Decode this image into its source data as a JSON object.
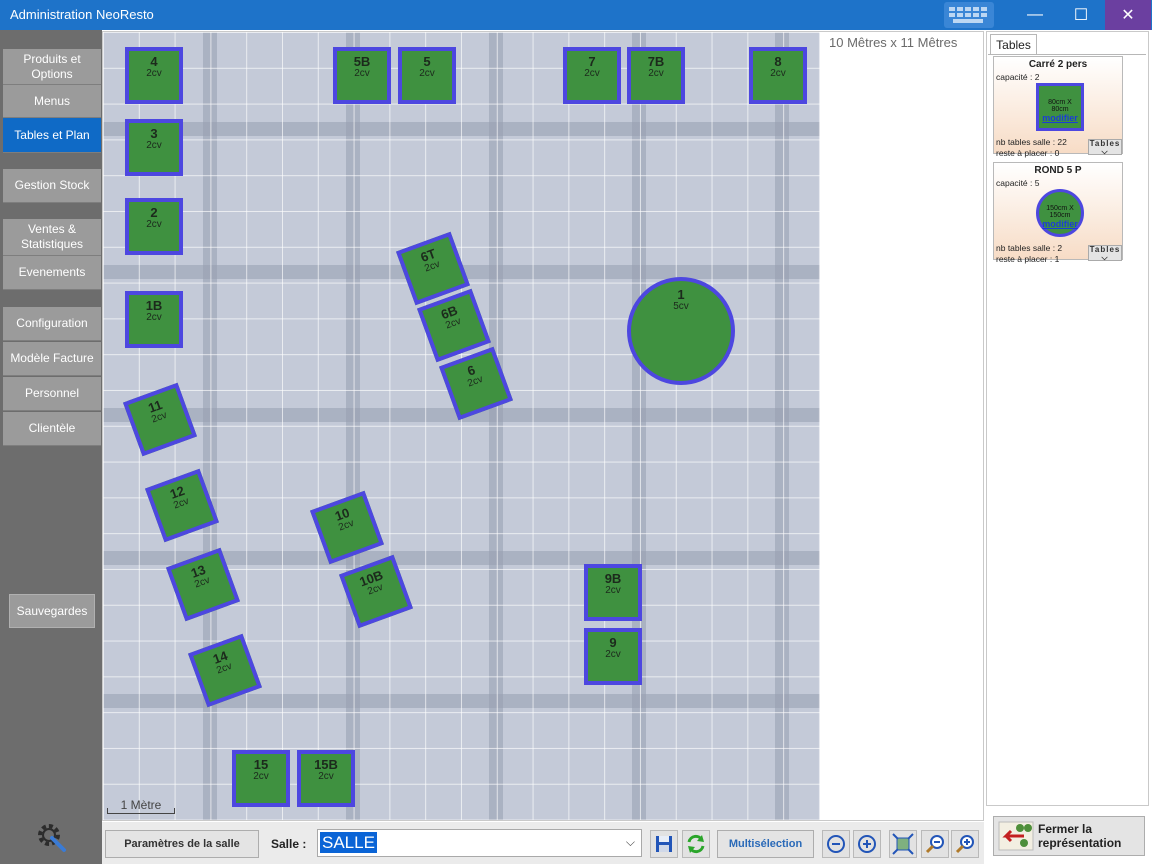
{
  "window": {
    "title": "Administration NeoResto",
    "minimize_glyph": "—",
    "maximize_glyph": "☐",
    "close_glyph": "✕"
  },
  "sidebar": {
    "items": [
      {
        "label": "Produits et Options",
        "active": false
      },
      {
        "label": "Menus",
        "active": false
      },
      {
        "label": "Tables et Plan",
        "active": true
      },
      {
        "label": "Gestion Stock",
        "active": false
      },
      {
        "label": "Ventes & Statistiques",
        "active": false
      },
      {
        "label": "Evenements",
        "active": false
      },
      {
        "label": "Configuration",
        "active": false
      },
      {
        "label": "Modèle Facture",
        "active": false
      },
      {
        "label": "Personnel",
        "active": false
      },
      {
        "label": "Clientèle",
        "active": false
      }
    ],
    "save_label": "Sauvegardes",
    "settings_icon": "gear-icon"
  },
  "plan": {
    "dimensions": "10 Mêtres x 11 Mêtres",
    "scale_label": "1 Mètre",
    "tables": [
      {
        "name": "4",
        "covers": "2cv"
      },
      {
        "name": "5B",
        "covers": "2cv"
      },
      {
        "name": "5",
        "covers": "2cv"
      },
      {
        "name": "7",
        "covers": "2cv"
      },
      {
        "name": "7B",
        "covers": "2cv"
      },
      {
        "name": "8",
        "covers": "2cv"
      },
      {
        "name": "3",
        "covers": "2cv"
      },
      {
        "name": "2",
        "covers": "2cv"
      },
      {
        "name": "1B",
        "covers": "2cv"
      },
      {
        "name": "6T",
        "covers": "2cv"
      },
      {
        "name": "6B",
        "covers": "2cv"
      },
      {
        "name": "6",
        "covers": "2cv"
      },
      {
        "name": "1",
        "covers": "5cv"
      },
      {
        "name": "11",
        "covers": "2cv"
      },
      {
        "name": "12",
        "covers": "2cv"
      },
      {
        "name": "10",
        "covers": "2cv"
      },
      {
        "name": "13",
        "covers": "2cv"
      },
      {
        "name": "10B",
        "covers": "2cv"
      },
      {
        "name": "9B",
        "covers": "2cv"
      },
      {
        "name": "9",
        "covers": "2cv"
      },
      {
        "name": "14",
        "covers": "2cv"
      },
      {
        "name": "15",
        "covers": "2cv"
      },
      {
        "name": "15B",
        "covers": "2cv"
      }
    ]
  },
  "toolbar": {
    "params_label": "Paramètres de la salle",
    "salle_label": "Salle :",
    "salle_value": "SALLE",
    "multi_label": "Multisélection",
    "colors": {
      "table_fill": "#3f9140",
      "table_border": "#4d47e0",
      "accent": "#0f6ac6"
    }
  },
  "right_panel": {
    "tab_label": "Tables",
    "cards": [
      {
        "title": "Carré 2 pers",
        "capacity": "capacité : 2",
        "size": "80cm X 80cm",
        "modify": "modifier",
        "nb": "nb tables salle : 22",
        "rest": "reste à placer : 0",
        "btn": "Tables"
      },
      {
        "title": "ROND 5 P",
        "capacity": "capacité : 5",
        "size": "150cm X 150cm",
        "modify": "modifier",
        "nb": "nb tables salle : 2",
        "rest": "reste à placer : 1",
        "btn": "Tables"
      }
    ],
    "close_label_1": "Fermer la",
    "close_label_2": "représentation"
  }
}
